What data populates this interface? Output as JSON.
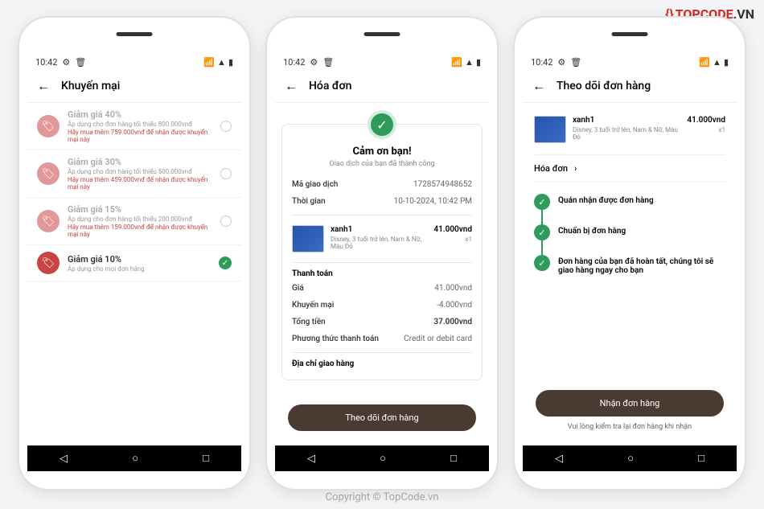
{
  "watermark": {
    "logo_brand": "TOPCODE",
    "logo_tld": ".VN",
    "center": "TopCode.vn",
    "bottom": "Copyright © TopCode.vn"
  },
  "status_bar": {
    "time": "10:42",
    "icons_left": [
      "⚙",
      "🗑"
    ],
    "icons_right": [
      "📶",
      "▲",
      "▮"
    ]
  },
  "nav": {
    "back": "◁",
    "home": "○",
    "recent": "□"
  },
  "screen1": {
    "title": "Khuyến mại",
    "promos": [
      {
        "title": "Giảm giá 40%",
        "desc": "Áp dụng cho đơn hàng tối thiểu 800.000vnđ",
        "warn": "Hãy mua thêm 759.000vnđ để nhận được khuyến mại này",
        "enabled": false
      },
      {
        "title": "Giảm giá 30%",
        "desc": "Áp dụng cho đơn hàng tối thiểu 500.000vnđ",
        "warn": "Hãy mua thêm 459.000vnđ để nhận được khuyến mại này",
        "enabled": false
      },
      {
        "title": "Giảm giá 15%",
        "desc": "Áp dụng cho đơn hàng tối thiểu 200.000vnđ",
        "warn": "Hãy mua thêm 159.000vnđ để nhận được khuyến mại này",
        "enabled": false
      },
      {
        "title": "Giảm giá 10%",
        "desc": "Áp dụng cho mọi đơn hàng",
        "warn": "",
        "enabled": true
      }
    ]
  },
  "screen2": {
    "title": "Hóa đơn",
    "thanks": "Cảm ơn bạn!",
    "subtitle": "Giao dịch của bạn đã thành công",
    "txn_id_label": "Mã giao dịch",
    "txn_id": "1728574948652",
    "time_label": "Thời gian",
    "time_value": "10-10-2024, 10:42 PM",
    "product": {
      "name": "xanh1",
      "desc": "Disney, 3 tuổi trở lên, Nam & Nữ, Màu Đỏ",
      "price": "41.000vnd",
      "qty": "x1"
    },
    "payment_header": "Thanh toán",
    "price_label": "Giá",
    "price_value": "41.000vnd",
    "promo_label": "Khuyến mại",
    "promo_value": "-4.000vnd",
    "total_label": "Tổng tiền",
    "total_value": "37.000vnd",
    "method_label": "Phương thức thanh toán",
    "method_value": "Credit or debit card",
    "address_header": "Địa chỉ giao hàng",
    "button": "Theo dõi đơn hàng"
  },
  "screen3": {
    "title": "Theo dõi đơn hàng",
    "product": {
      "name": "xanh1",
      "desc": "Disney, 3 tuổi trở lên, Nam & Nữ, Màu Đỏ",
      "price": "41.000vnd",
      "qty": "x1"
    },
    "invoice_link": "Hóa đơn",
    "steps": [
      "Quán nhận được đơn hàng",
      "Chuẩn bị đơn hàng",
      "Đơn hàng của bạn đã hoàn tất, chúng tôi sẽ giao hàng ngay cho bạn"
    ],
    "button": "Nhận đơn hàng",
    "note": "Vui lòng kiểm tra lại đơn hàng khi nhận"
  }
}
